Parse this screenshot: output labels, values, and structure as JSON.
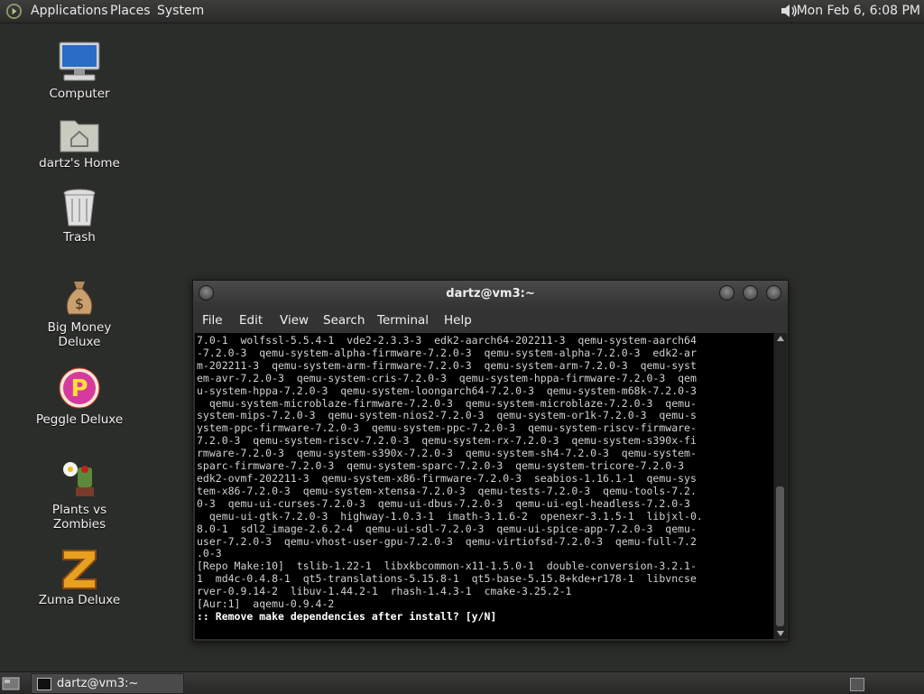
{
  "top_panel": {
    "menus": [
      "Applications",
      "Places",
      "System"
    ],
    "clock": "Mon Feb  6,  6:08 PM"
  },
  "desktop": {
    "icons": [
      {
        "label": "Computer",
        "icon": "computer-icon"
      },
      {
        "label": "dartz's Home",
        "icon": "home-folder-icon"
      },
      {
        "label": "Trash",
        "icon": "trash-icon"
      },
      {
        "label": "Big Money Deluxe",
        "icon": "money-bag-icon"
      },
      {
        "label": "Peggle Deluxe",
        "icon": "peggle-icon"
      },
      {
        "label": "Plants vs Zombies",
        "icon": "plants-vs-zombies-icon"
      },
      {
        "label": "Zuma Deluxe",
        "icon": "zuma-icon"
      }
    ]
  },
  "terminal": {
    "title": "dartz@vm3:~",
    "menus": [
      "File",
      "Edit",
      "View",
      "Search",
      "Terminal",
      "Help"
    ],
    "lines": [
      "7.0-1  wolfssl-5.5.4-1  vde2-2.3.3-3  edk2-aarch64-202211-3  qemu-system-aarch64",
      "-7.2.0-3  qemu-system-alpha-firmware-7.2.0-3  qemu-system-alpha-7.2.0-3  edk2-ar",
      "m-202211-3  qemu-system-arm-firmware-7.2.0-3  qemu-system-arm-7.2.0-3  qemu-syst",
      "em-avr-7.2.0-3  qemu-system-cris-7.2.0-3  qemu-system-hppa-firmware-7.2.0-3  qem",
      "u-system-hppa-7.2.0-3  qemu-system-loongarch64-7.2.0-3  qemu-system-m68k-7.2.0-3",
      "  qemu-system-microblaze-firmware-7.2.0-3  qemu-system-microblaze-7.2.0-3  qemu-",
      "system-mips-7.2.0-3  qemu-system-nios2-7.2.0-3  qemu-system-or1k-7.2.0-3  qemu-s",
      "ystem-ppc-firmware-7.2.0-3  qemu-system-ppc-7.2.0-3  qemu-system-riscv-firmware-",
      "7.2.0-3  qemu-system-riscv-7.2.0-3  qemu-system-rx-7.2.0-3  qemu-system-s390x-fi",
      "rmware-7.2.0-3  qemu-system-s390x-7.2.0-3  qemu-system-sh4-7.2.0-3  qemu-system-",
      "sparc-firmware-7.2.0-3  qemu-system-sparc-7.2.0-3  qemu-system-tricore-7.2.0-3",
      "edk2-ovmf-202211-3  qemu-system-x86-firmware-7.2.0-3  seabios-1.16.1-1  qemu-sys",
      "tem-x86-7.2.0-3  qemu-system-xtensa-7.2.0-3  qemu-tests-7.2.0-3  qemu-tools-7.2.",
      "0-3  qemu-ui-curses-7.2.0-3  qemu-ui-dbus-7.2.0-3  qemu-ui-egl-headless-7.2.0-3",
      "  qemu-ui-gtk-7.2.0-3  highway-1.0.3-1  imath-3.1.6-2  openexr-3.1.5-1  libjxl-0.",
      "8.0-1  sdl2_image-2.6.2-4  qemu-ui-sdl-7.2.0-3  qemu-ui-spice-app-7.2.0-3  qemu-",
      "user-7.2.0-3  qemu-vhost-user-gpu-7.2.0-3  qemu-virtiofsd-7.2.0-3  qemu-full-7.2",
      ".0-3",
      "[Repo Make:10]  tslib-1.22-1  libxkbcommon-x11-1.5.0-1  double-conversion-3.2.1-",
      "1  md4c-0.4.8-1  qt5-translations-5.15.8-1  qt5-base-5.15.8+kde+r178-1  libvncse",
      "rver-0.9.14-2  libuv-1.44.2-1  rhash-1.4.3-1  cmake-3.25.2-1",
      "[Aur:1]  aqemu-0.9.4-2",
      ""
    ],
    "prompt": ":: Remove make dependencies after install? [y/N]"
  },
  "bottom_panel": {
    "task_label": "dartz@vm3:~"
  }
}
